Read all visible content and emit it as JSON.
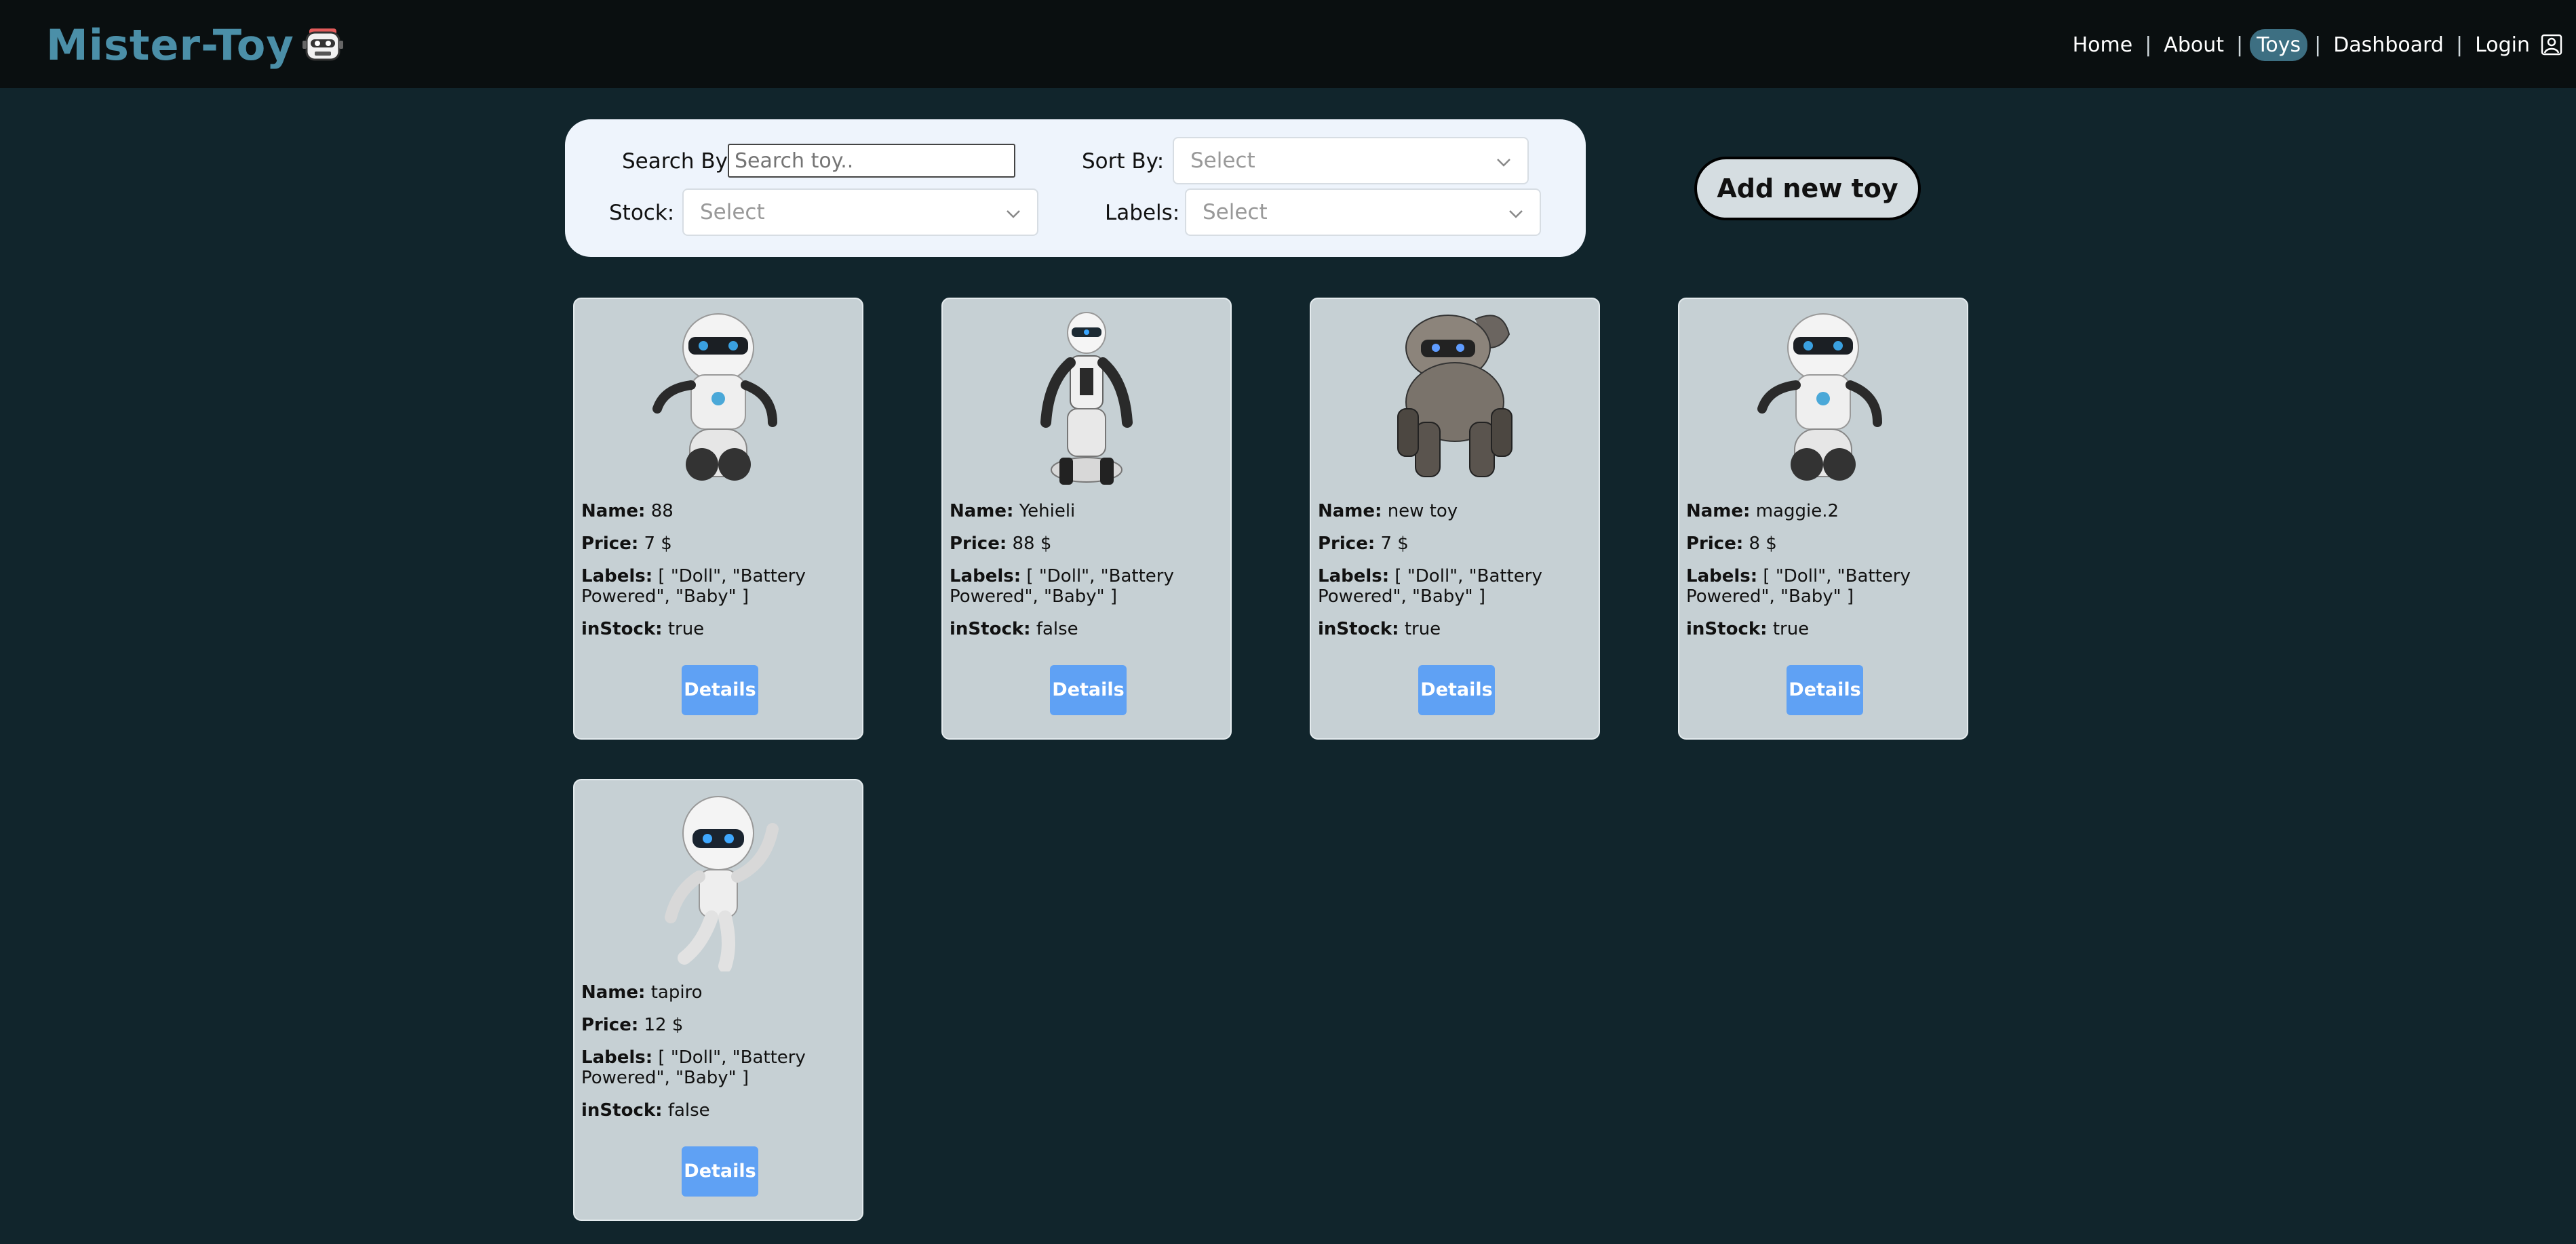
{
  "header": {
    "logo": "Mister-Toy",
    "nav": [
      {
        "label": "Home"
      },
      {
        "label": "About"
      },
      {
        "label": "Toys"
      },
      {
        "label": "Dashboard"
      },
      {
        "label": "Login"
      }
    ]
  },
  "filters": {
    "search_label": "Search By",
    "search_placeholder": "Search toy..",
    "sort_label": "Sort By:",
    "sort_value": "Select",
    "stock_label": "Stock:",
    "stock_value": "Select",
    "labels_label": "Labels:",
    "labels_value": "Select"
  },
  "add_button": "Add new toy",
  "card_labels": {
    "name": "Name:",
    "price": "Price:",
    "labels": "Labels:",
    "instock": "inStock:",
    "details": "Details"
  },
  "toys": [
    {
      "name": "88",
      "price": "7 $",
      "labels": "[ \"Doll\", \"Battery Powered\", \"Baby\" ]",
      "inStock": "true",
      "icon": "white-robot-icon"
    },
    {
      "name": "Yehieli",
      "price": "88 $",
      "labels": "[ \"Doll\", \"Battery Powered\", \"Baby\" ]",
      "inStock": "false",
      "icon": "humanoid-robot-icon"
    },
    {
      "name": "new toy",
      "price": "7 $",
      "labels": "[ \"Doll\", \"Battery Powered\", \"Baby\" ]",
      "inStock": "true",
      "icon": "robot-dog-icon"
    },
    {
      "name": "maggie.2",
      "price": "8 $",
      "labels": "[ \"Doll\", \"Battery Powered\", \"Baby\" ]",
      "inStock": "true",
      "icon": "white-robot-icon"
    },
    {
      "name": "tapiro",
      "price": "12 $",
      "labels": "[ \"Doll\", \"Battery Powered\", \"Baby\" ]",
      "inStock": "false",
      "icon": "flying-robot-icon"
    }
  ]
}
